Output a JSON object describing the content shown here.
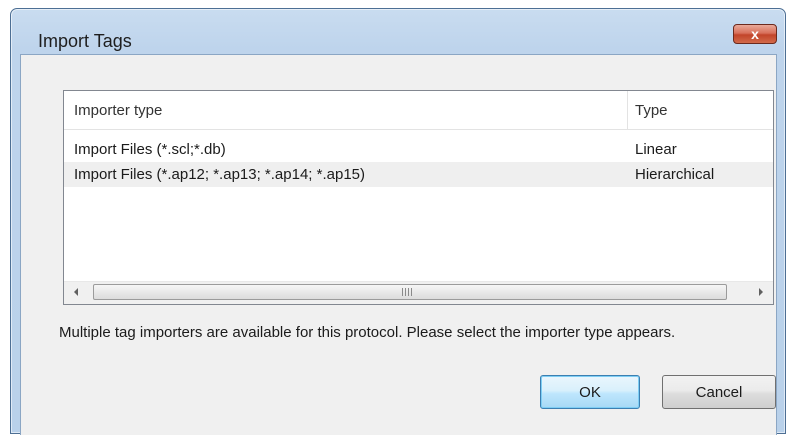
{
  "window": {
    "title": "Import Tags",
    "close_glyph": "x"
  },
  "importer_list": {
    "columns": [
      "Importer type",
      "Type"
    ],
    "rows": [
      {
        "importer": "Import Files (*.scl;*.db)",
        "type": "Linear"
      },
      {
        "importer": "Import Files (*.ap12; *.ap13; *.ap14; *.ap15)",
        "type": "Hierarchical"
      }
    ],
    "scrollbar_grip": "III"
  },
  "message": "Multiple tag importers are available for this protocol. Please select the importer type appears.",
  "buttons": {
    "ok": "OK",
    "cancel": "Cancel"
  },
  "icons": [
    "close-icon",
    "scroll-left-arrow-icon",
    "scroll-right-arrow-icon"
  ],
  "colors": {
    "frame": "#bed4ec",
    "close_button": "#c7432a",
    "default_button": "#bee6fd"
  }
}
